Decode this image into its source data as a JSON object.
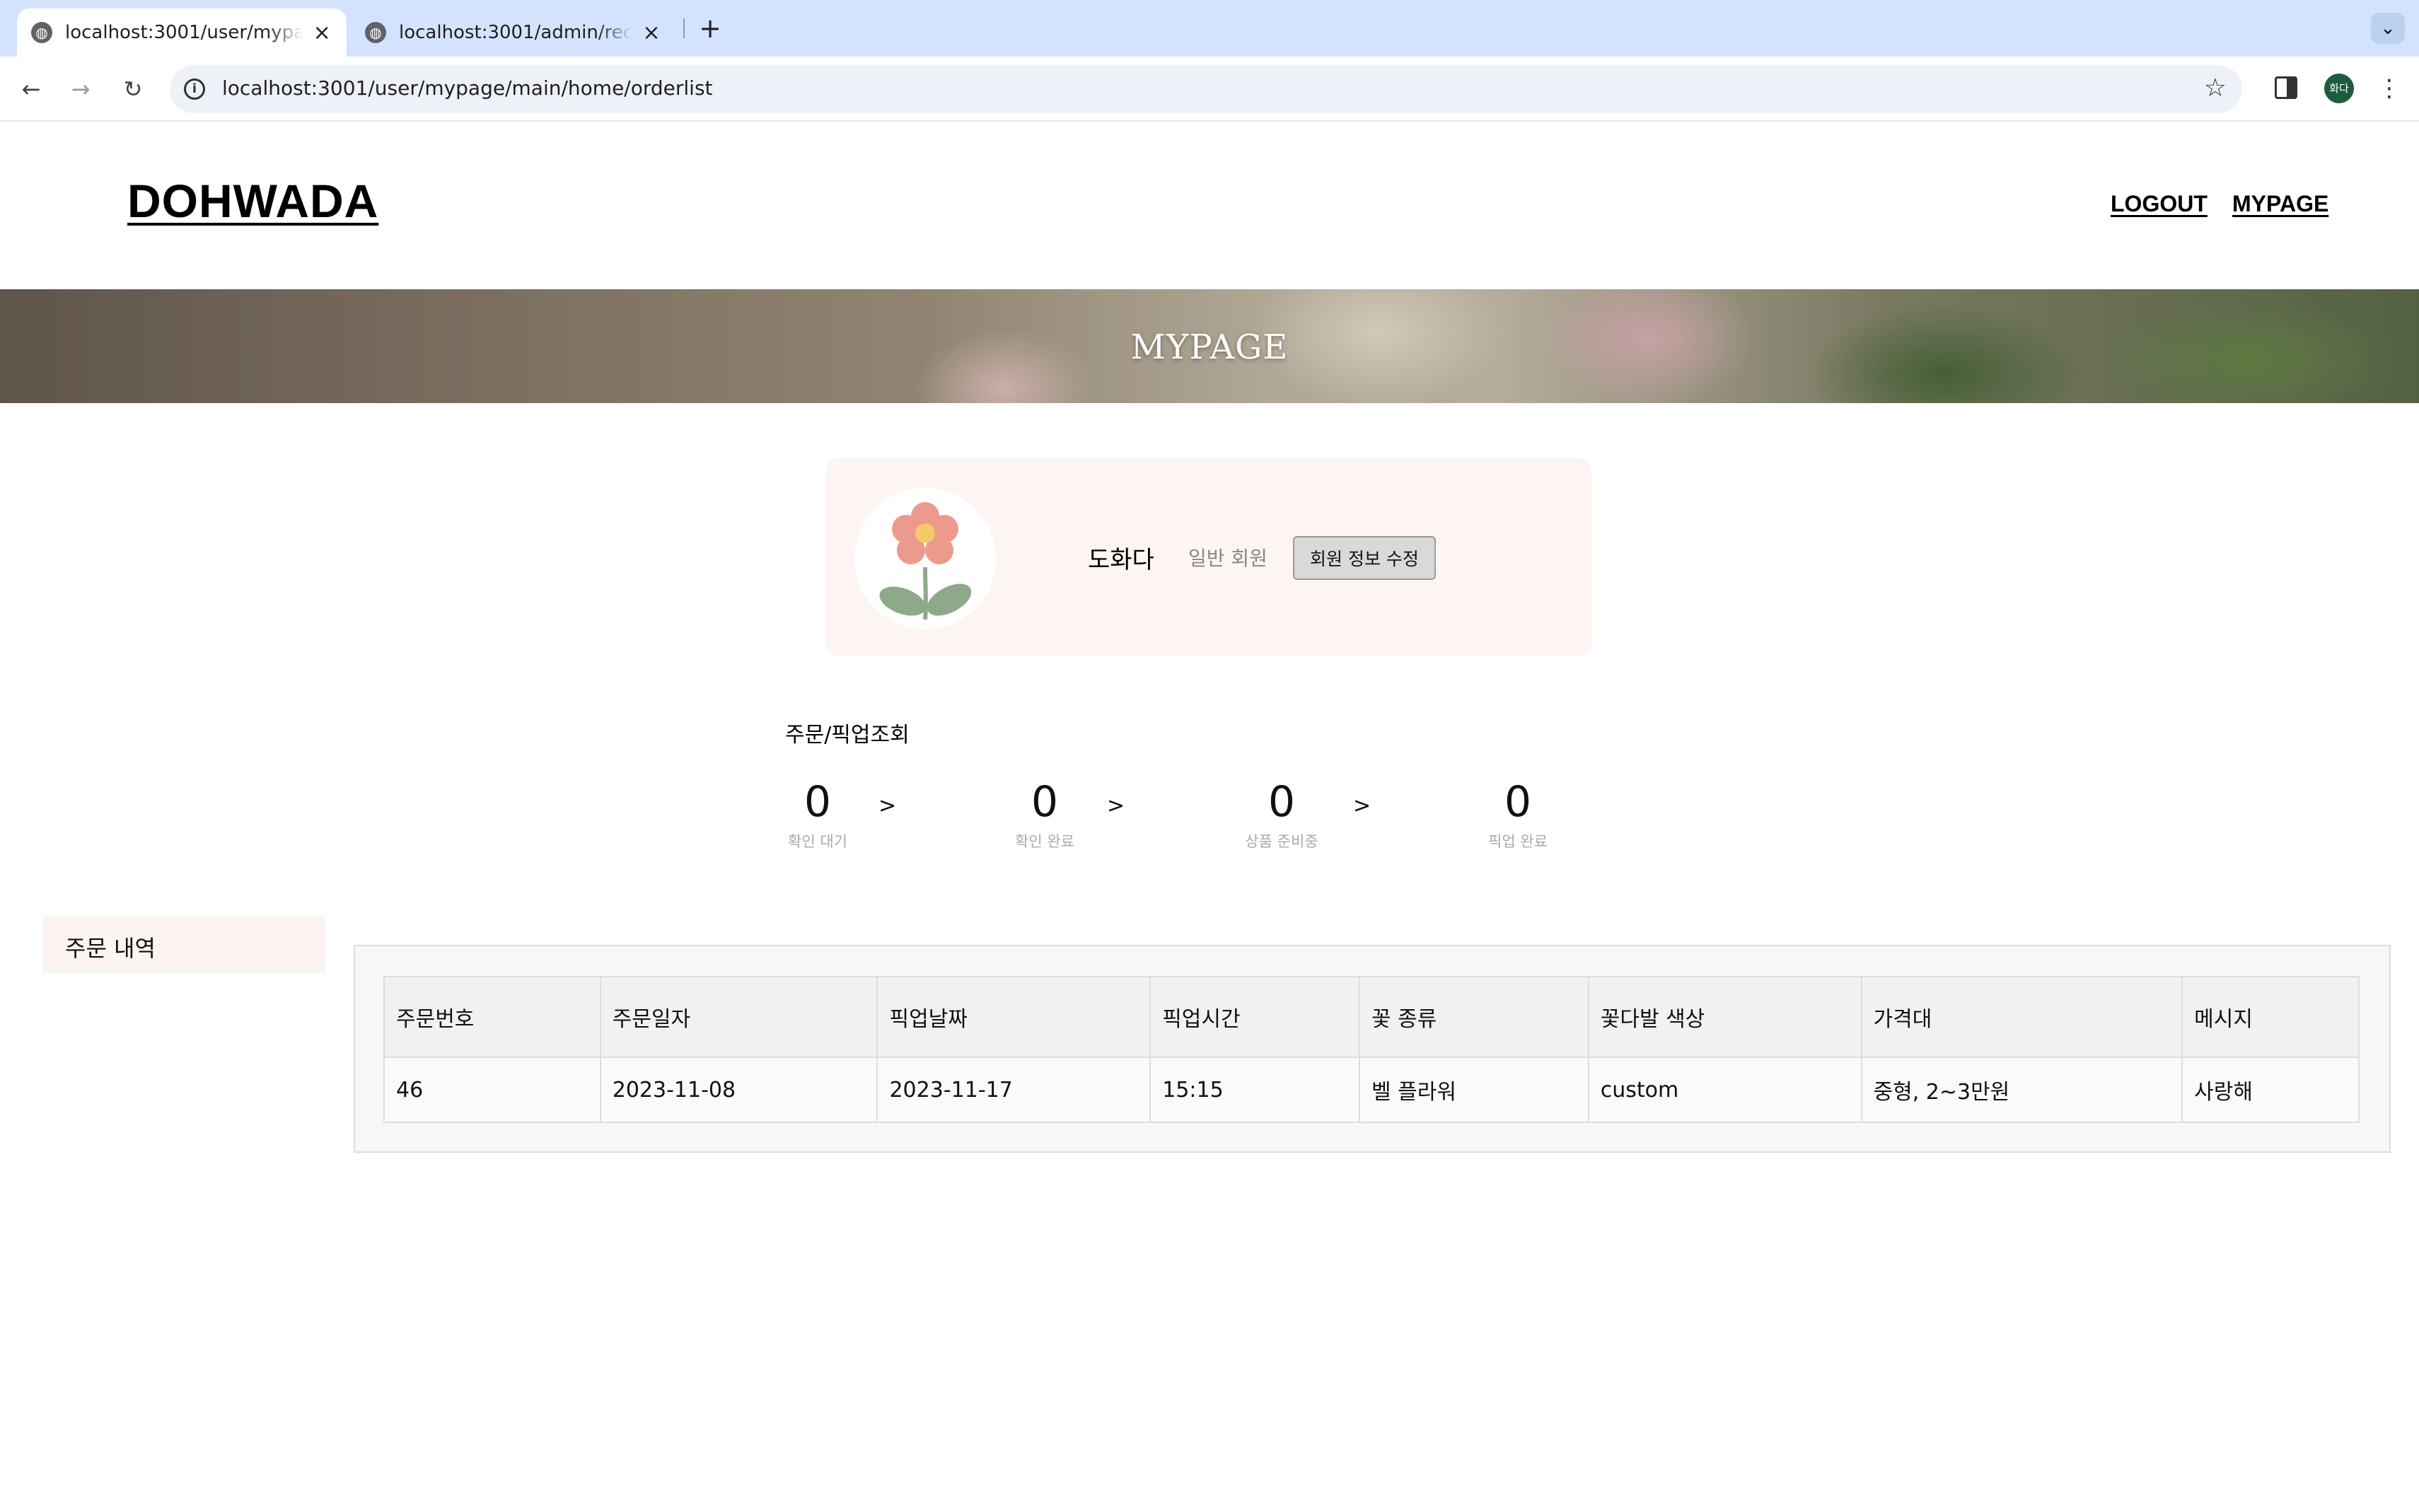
{
  "browser": {
    "tabs": [
      {
        "title": "localhost:3001/user/mypage/main/home/orderlist",
        "active": true
      },
      {
        "title": "localhost:3001/admin/recommend",
        "active": false
      }
    ],
    "url": "localhost:3001/user/mypage/main/home/orderlist",
    "profile_initials": "화다"
  },
  "site": {
    "logo": "DOHWADA",
    "nav": {
      "logout": "LOGOUT",
      "mypage": "MYPAGE"
    },
    "banner_title": "MYPAGE"
  },
  "profile": {
    "name": "도화다",
    "grade": "일반 회원",
    "edit_button": "회원 정보 수정"
  },
  "order_status": {
    "title": "주문/픽업조회",
    "steps": [
      {
        "count": "0",
        "label": "확인 대기"
      },
      {
        "count": "0",
        "label": "확인 완료"
      },
      {
        "count": "0",
        "label": "상품 준비중"
      },
      {
        "count": "0",
        "label": "픽업 완료"
      }
    ],
    "separator": ">"
  },
  "side_menu": {
    "order_history": "주문 내역"
  },
  "orders": {
    "columns": [
      "주문번호",
      "주문일자",
      "픽업날짜",
      "픽업시간",
      "꽃 종류",
      "꽃다발 색상",
      "가격대",
      "메시지"
    ],
    "rows": [
      [
        "46",
        "2023-11-08",
        "2023-11-17",
        "15:15",
        "벨 플라워",
        "custom",
        "중형, 2~3만원",
        "사랑해"
      ]
    ]
  },
  "colors": {
    "tab_strip": "#d3e3fd",
    "card_background": "#fdf5f2",
    "side_menu_background": "#fcf4f1",
    "flower_petal": "#ec9a8c",
    "flower_center": "#f6c96b",
    "leaf": "#8ea98a"
  },
  "icons": [
    "globe-icon",
    "close-icon",
    "plus-icon",
    "chevron-down-icon",
    "back-arrow-icon",
    "forward-arrow-icon",
    "reload-icon",
    "info-icon",
    "star-icon",
    "side-panel-icon",
    "more-vertical-icon",
    "flower-avatar-icon"
  ]
}
